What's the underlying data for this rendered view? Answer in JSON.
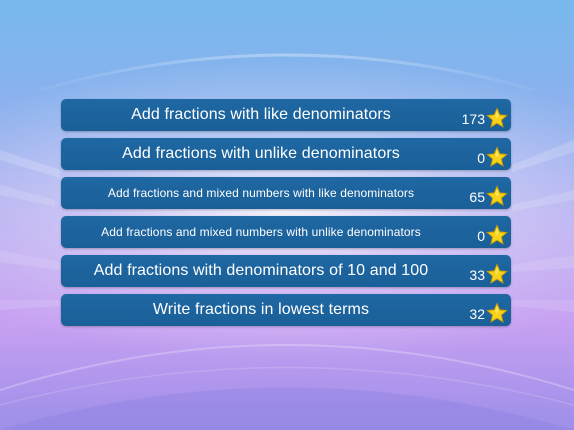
{
  "skills": [
    {
      "label": "Add fractions with like denominators",
      "score": "173",
      "size": "large"
    },
    {
      "label": "Add fractions with unlike denominators",
      "score": "0",
      "size": "large"
    },
    {
      "label": "Add fractions and mixed numbers with like denominators",
      "score": "65",
      "size": "small"
    },
    {
      "label": "Add fractions and mixed numbers with unlike denominators",
      "score": "0",
      "size": "small"
    },
    {
      "label": "Add fractions with denominators of 10 and 100",
      "score": "33",
      "size": "large"
    },
    {
      "label": "Write fractions in lowest terms",
      "score": "32",
      "size": "large"
    }
  ],
  "icons": {
    "score": "star-icon"
  },
  "colors": {
    "row_background": "#1a5f98",
    "star_fill": "#f7d21a",
    "star_outline": "#c99a00",
    "text": "#ffffff"
  }
}
